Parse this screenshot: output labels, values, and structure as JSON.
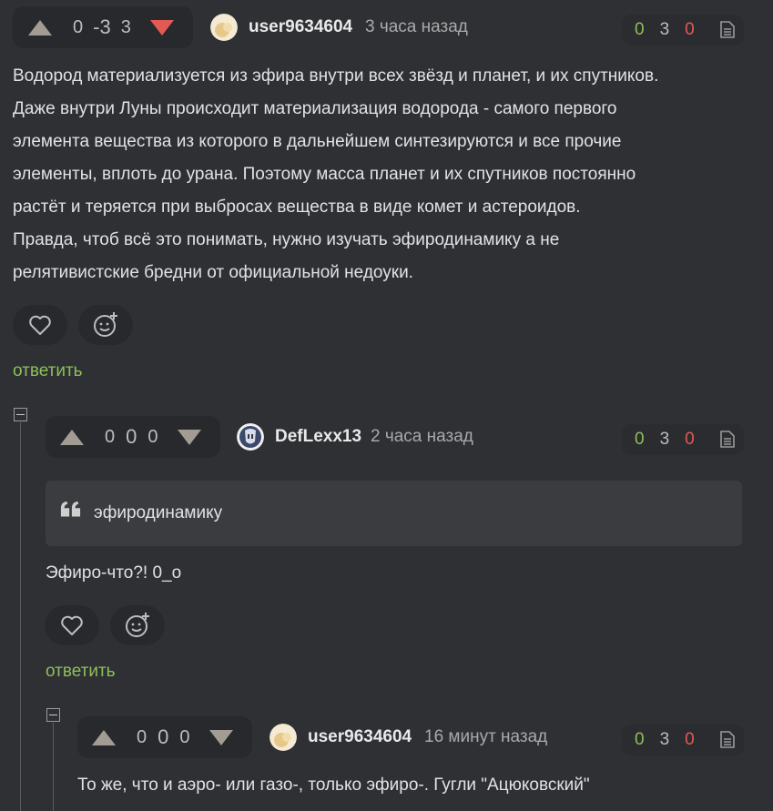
{
  "comments": [
    {
      "rating": {
        "plus": "0",
        "total": "-3",
        "minus": "3"
      },
      "author": "user9634604",
      "time": "3 часа назад",
      "stats": {
        "a": "0",
        "b": "3",
        "c": "0"
      },
      "body_lines": [
        "Водород материализуется из эфира внутри всех звёзд и планет, и их спутников.",
        "Даже внутри Луны происходит материализация водорода - самого первого",
        "элемента вещества из которого в дальнейшем синтезируются и все прочие",
        "элементы, вплоть до урана. Поэтому масса планет и их спутников постоянно",
        "растёт и теряется при выбросах вещества в виде комет и астероидов.",
        "Правда, чтоб всё это понимать, нужно изучать эфиродинамику а не",
        "релятивистские бредни от официальной недоуки."
      ],
      "reply_label": "ответить"
    },
    {
      "rating": {
        "plus": "0",
        "total": "0",
        "minus": "0"
      },
      "author": "DefLexx13",
      "time": "2 часа назад",
      "stats": {
        "a": "0",
        "b": "3",
        "c": "0"
      },
      "quote": "эфиродинамику",
      "body": "Эфиро-что?! 0_о",
      "reply_label": "ответить"
    },
    {
      "rating": {
        "plus": "0",
        "total": "0",
        "minus": "0"
      },
      "author": "user9634604",
      "time": "16 минут назад",
      "stats": {
        "a": "0",
        "b": "3",
        "c": "0"
      },
      "body": "То же, что и аэро- или газо-, только эфиро-. Гугли \"Ацюковский\""
    }
  ],
  "colors": {
    "background": "#2e3034",
    "accent_green": "#8fbf5a",
    "downvote_red": "#e35a55"
  },
  "icons": [
    "heart-icon",
    "smile-plus-icon",
    "document-icon",
    "upvote-arrow",
    "downvote-arrow",
    "quote-icon"
  ]
}
